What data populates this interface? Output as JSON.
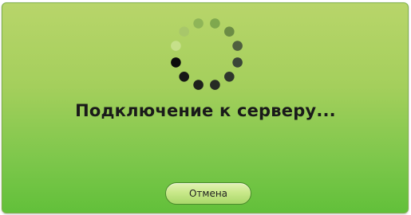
{
  "dialog": {
    "status_text": "Подключение к серверу...",
    "cancel_label": "Отмена"
  },
  "spinner": {
    "dot_colors": [
      "#7fa84e",
      "#6c8c45",
      "#4f5f3f",
      "#3a4638",
      "#2f362d",
      "#262b24",
      "#1e211c",
      "#161816",
      "#0c0c0c",
      "#c6e08a",
      "#a8c76a",
      "#8fb558"
    ]
  },
  "colors": {
    "dialog_gradient_top": "#b8d56a",
    "dialog_gradient_bottom": "#62c03a",
    "button_border": "#4b8a2c"
  }
}
